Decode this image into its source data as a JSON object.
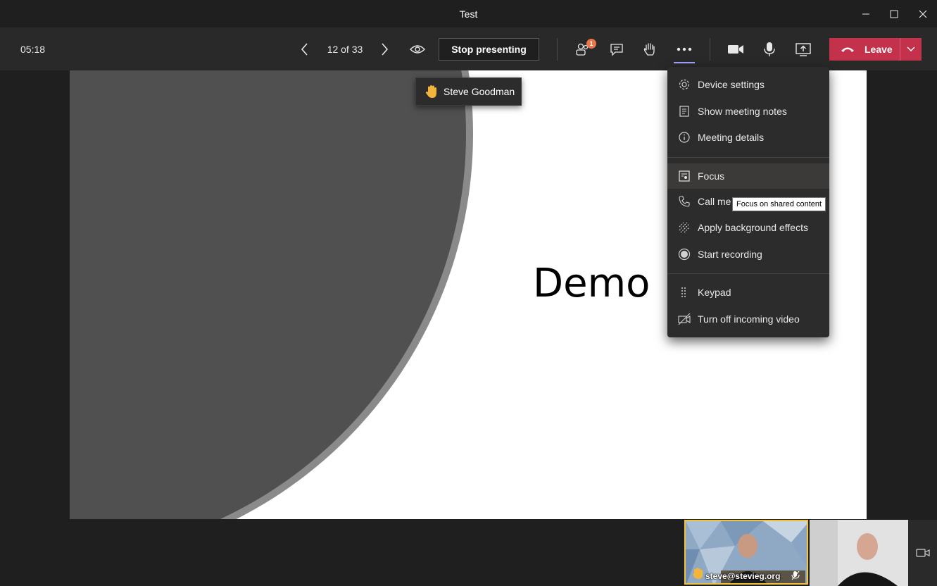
{
  "window": {
    "title": "Test",
    "minimize_icon": "minimize-icon",
    "maximize_icon": "maximize-icon",
    "close_icon": "close-icon"
  },
  "toolbar": {
    "timer": "05:18",
    "pager": "12 of 33",
    "stop_presenting_label": "Stop presenting",
    "participants_badge": "1",
    "leave_label": "Leave",
    "leave_color": "#c4314b"
  },
  "slide": {
    "title": "Demo"
  },
  "raised_hand": {
    "name": "Steve Goodman"
  },
  "more_menu": {
    "items": [
      {
        "label": "Device settings",
        "icon": "gear-icon"
      },
      {
        "label": "Show meeting notes",
        "icon": "notes-icon"
      },
      {
        "label": "Meeting details",
        "icon": "info-icon"
      },
      {
        "label": "Focus",
        "icon": "focus-icon"
      },
      {
        "label": "Call me",
        "icon": "phone-icon"
      },
      {
        "label": "Apply background effects",
        "icon": "background-effects-icon"
      },
      {
        "label": "Start recording",
        "icon": "record-icon"
      },
      {
        "label": "Keypad",
        "icon": "keypad-icon"
      },
      {
        "label": "Turn off incoming video",
        "icon": "video-off-icon"
      }
    ],
    "tooltip": "Focus on shared content"
  },
  "video": {
    "self_caption": "steve@stevieg.org"
  },
  "colors": {
    "accent": "#9ea2ff",
    "badge": "#e97548",
    "self_highlight": "#f0c43c"
  }
}
